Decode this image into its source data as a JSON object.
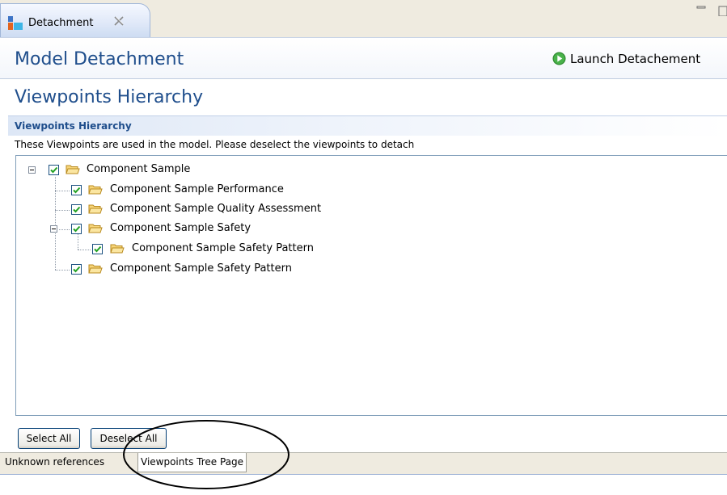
{
  "editor_tab": {
    "title": "Detachment",
    "icon": "detachment-app-icon",
    "close_icon": "close-icon"
  },
  "form": {
    "title": "Model Detachment",
    "launch_label": "Launch Detachement",
    "launch_icon": "run-icon"
  },
  "page": {
    "title": "Viewpoints Hierarchy"
  },
  "section": {
    "title": "Viewpoints Hierarchy",
    "description": "These Viewpoints are used in the model. Please deselect the viewpoints to detach"
  },
  "tree": {
    "nodes": [
      {
        "label": "Component Sample",
        "checked": true,
        "expanded": true,
        "level": 0,
        "icon": "folder-icon"
      },
      {
        "label": "Component Sample Performance",
        "checked": true,
        "level": 1,
        "icon": "folder-icon"
      },
      {
        "label": "Component Sample Quality Assessment",
        "checked": true,
        "level": 1,
        "icon": "folder-icon"
      },
      {
        "label": "Component Sample Safety",
        "checked": true,
        "expanded": true,
        "level": 1,
        "icon": "folder-icon"
      },
      {
        "label": "Component Sample Safety Pattern",
        "checked": true,
        "level": 2,
        "icon": "folder-icon"
      },
      {
        "label": "Component Sample Safety Pattern",
        "checked": true,
        "level": 1,
        "icon": "folder-icon"
      }
    ]
  },
  "buttons": {
    "select_all": "Select All",
    "deselect_all": "Deselect All"
  },
  "page_tabs": [
    {
      "label": "Unknown references",
      "active": false
    },
    {
      "label": "Viewpoints Tree Page",
      "active": true
    }
  ],
  "colors": {
    "title_blue": "#1f4e8c",
    "check_green": "#21a121",
    "folder_yellow": "#f3c45a"
  }
}
